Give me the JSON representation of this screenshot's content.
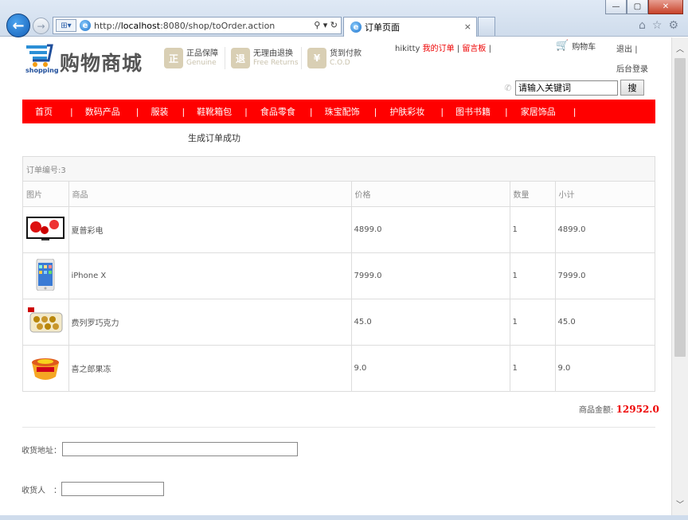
{
  "browser": {
    "url_prefix": "http://",
    "url_host": "localhost",
    "url_rest": ":8080/shop/toOrder.action",
    "addr_tools": "⚲ ▾ ↻",
    "tab_title": "订单页面",
    "tab_close": "×",
    "back_icon": "←",
    "forward_icon": "→",
    "minimize": "—",
    "maximize": "▢",
    "close": "✕"
  },
  "header": {
    "logo_text": "购物商城",
    "logo_sub": "shopping",
    "features": [
      {
        "icon": "正",
        "title": "正品保障",
        "sub": "Genuine"
      },
      {
        "icon": "退",
        "title": "无理由退换",
        "sub": "Free Returns"
      },
      {
        "icon": "¥",
        "title": "货到付款",
        "sub": "C.O.D"
      }
    ],
    "username": "hikitty",
    "my_orders": "我的订单",
    "sep1": "|",
    "message_board": "留言板",
    "sep2": "|",
    "cart": "购物车",
    "logout": "退出",
    "logout_sep": "|",
    "admin_login": "后台登录",
    "search_placeholder": "请输入关键词",
    "search_button": "搜"
  },
  "nav": {
    "items": [
      "首页",
      "数码产品",
      "服装",
      "鞋靴箱包",
      "食品零食",
      "珠宝配饰",
      "护肤彩妆",
      "图书书籍",
      "家居饰品"
    ],
    "sep": "|"
  },
  "order": {
    "success_message": "生成订单成功",
    "order_number": "订单编号:3",
    "columns": [
      "图片",
      "商品",
      "价格",
      "数量",
      "小计"
    ],
    "rows": [
      {
        "name": "夏普彩电",
        "price": "4899.0",
        "qty": "1",
        "subtotal": "4899.0"
      },
      {
        "name": "iPhone X",
        "price": "7999.0",
        "qty": "1",
        "subtotal": "7999.0"
      },
      {
        "name": "费列罗巧克力",
        "price": "45.0",
        "qty": "1",
        "subtotal": "45.0"
      },
      {
        "name": "喜之郎果冻",
        "price": "9.0",
        "qty": "1",
        "subtotal": "9.0"
      }
    ],
    "total_label": "商品金额:",
    "total_value": "12952.0"
  },
  "form": {
    "address_label": "收货地址：",
    "address_value": "",
    "receiver_label": "收货人　：",
    "receiver_value": ""
  },
  "colors": {
    "brand_red": "#ff0000",
    "price_red": "#ee0000"
  }
}
